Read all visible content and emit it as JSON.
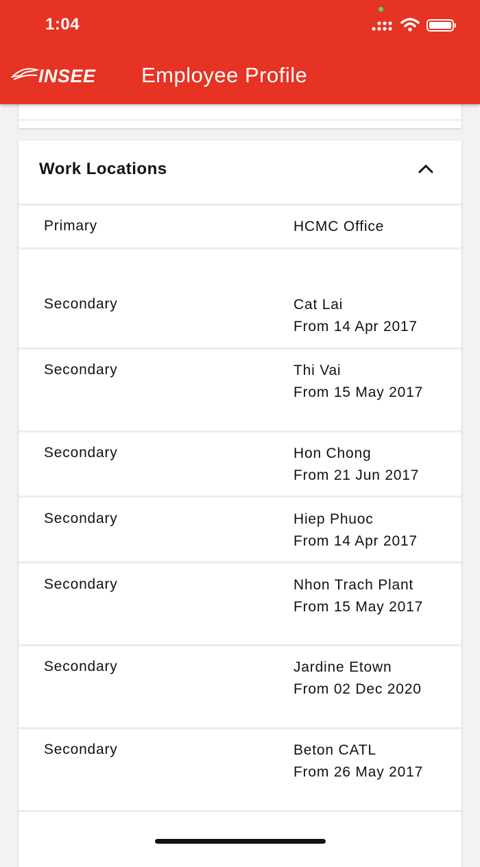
{
  "status_bar": {
    "time": "1:04"
  },
  "header": {
    "logo_text": "INSEE",
    "title": "Employee Profile",
    "background": "#e63323"
  },
  "work_locations": {
    "title": "Work Locations",
    "rows": [
      {
        "type": "Primary",
        "location": "HCMC Office",
        "from": ""
      },
      {
        "type": "Secondary",
        "location": "Cat Lai",
        "from": "From 14 Apr 2017"
      },
      {
        "type": "Secondary",
        "location": "Thi Vai",
        "from": "From 15 May 2017"
      },
      {
        "type": "Secondary",
        "location": "Hon Chong",
        "from": "From 21 Jun 2017"
      },
      {
        "type": "Secondary",
        "location": "Hiep Phuoc",
        "from": "From 14 Apr 2017"
      },
      {
        "type": "Secondary",
        "location": "Nhon Trach Plant",
        "from": "From 15 May 2017"
      },
      {
        "type": "Secondary",
        "location": "Jardine Etown",
        "from": "From 02 Dec 2020"
      },
      {
        "type": "Secondary",
        "location": "Beton CATL",
        "from": "From 26 May 2017"
      }
    ]
  }
}
